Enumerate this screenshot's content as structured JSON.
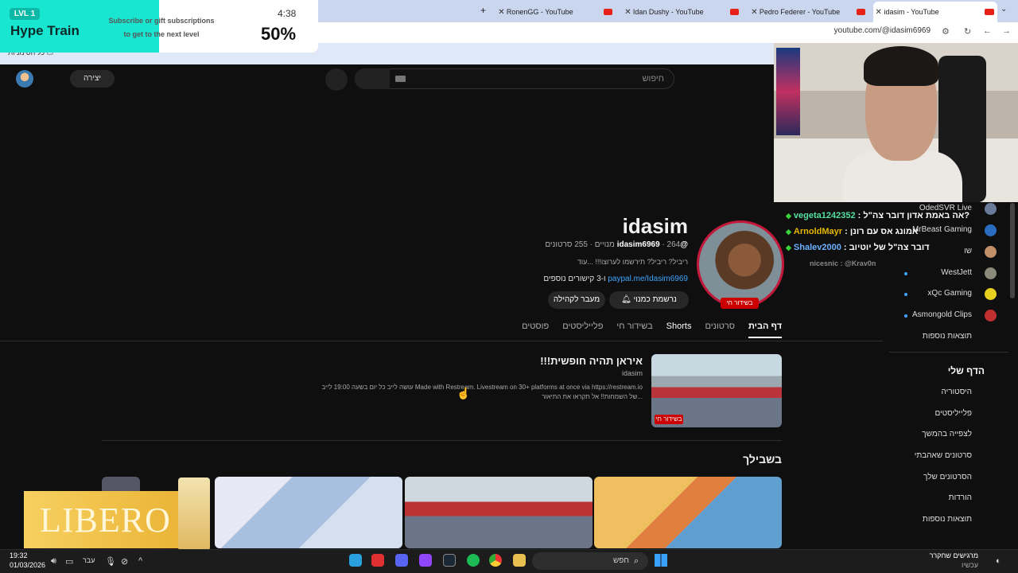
{
  "hype_train": {
    "level": "LVL 1",
    "title": "Hype Train",
    "subtitle_line1": "Subscribe or gift subscriptions",
    "subtitle_line2": "to get to the next level",
    "time": "4:38",
    "percent": "50%"
  },
  "browser": {
    "tabs": [
      {
        "label": "RonenGG - YouTube"
      },
      {
        "label": "Idan Dushy - YouTube"
      },
      {
        "label": "Pedro Federer - YouTube"
      },
      {
        "label": "idasim - YouTube"
      }
    ],
    "url": "youtube.com/@idasim6969",
    "bookmarks_label": "כל הסימניות"
  },
  "header": {
    "create_label": "יצירה",
    "search_placeholder": "חיפוש"
  },
  "channel": {
    "name": "idasim",
    "handle": "@idasim6969",
    "stats": " · 264 מנויים · 255 סרטונים",
    "description": "ריביל? ריביל? תירשמו לערוצו!!! ...עוד",
    "link": "paypal.me/Idasim6969",
    "links_more": " ו-3 קישורים נוספים",
    "live_badge": "בשידור חי",
    "subscribed_label": "נרשמת כמנוי",
    "community_label": "מעבר לקהילה",
    "tabs": [
      "דף הבית",
      "סרטונים",
      "Shorts",
      "בשידור חי",
      "פלייליסטים",
      "פוסטים"
    ]
  },
  "featured": {
    "title": "איראן תהיה חופשית!!!",
    "owner": "idasim",
    "desc_line1": "Made with Restream. Livestream on 30+ platforms at once via https://restream.io עושה לייב כל יום בשעה 19:00 לייב",
    "desc_line2": "...של השמחות!! אל תקראו את התיאור",
    "live_badge": "בשידור חי"
  },
  "for_you": "בשבילך",
  "sidebar": {
    "channels": [
      {
        "name": "OdedSVR Live"
      },
      {
        "name": "MrBeast Gaming"
      },
      {
        "name": "שו"
      },
      {
        "name": "WestJett"
      },
      {
        "name": "xQc Gaming"
      },
      {
        "name": "Asmongold Clips"
      }
    ],
    "show_more": "תוצאות נוספות",
    "my_page": "הדף שלי",
    "items": [
      "היסטוריה",
      "פלייליסטים",
      "לצפייה בהמשך",
      "סרטונים שאהבתי",
      "הסרטונים שלך",
      "הורדות",
      "תוצאות נוספות"
    ]
  },
  "chat": [
    {
      "user": "vegeta1242352",
      "message": " : אה באמת אדון דובר צה\"ל?",
      "color": "#53e0a0"
    },
    {
      "user": "ArnoldMayr",
      "message": " : אמונג אס עם רונן",
      "color": "#e6b800"
    },
    {
      "user": "Shalev2000",
      "message": " : דובר צה\"ל של יוטיוב",
      "color": "#6ab0ff"
    },
    {
      "user": "nicesnic",
      "message": " : @Krav0n",
      "color": "#888888"
    }
  ],
  "ad": {
    "brand": "LIBERO"
  },
  "taskbar": {
    "time": "19:32",
    "date": "01/03/2026",
    "lang": "עבר",
    "search_placeholder": "חפש",
    "notif_line1": "מרגישים שחקרר",
    "notif_line2": "עכשיו"
  }
}
